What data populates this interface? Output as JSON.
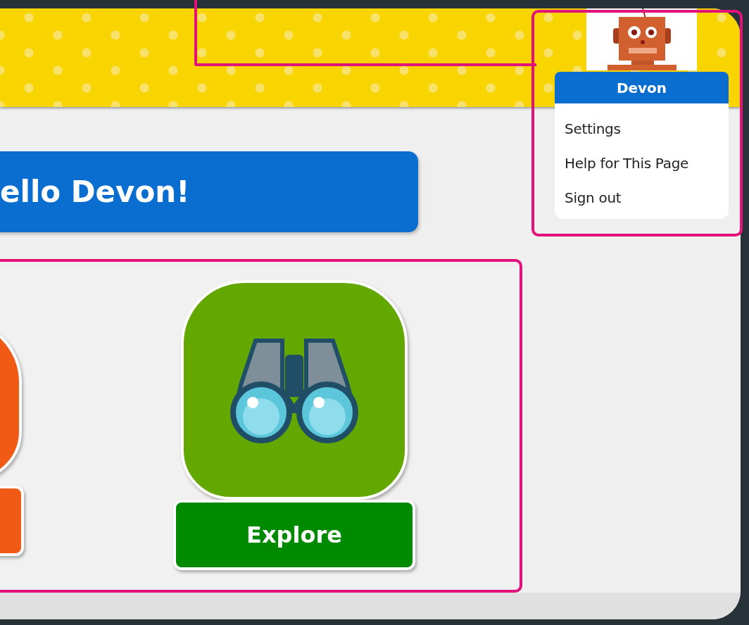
{
  "user_menu": {
    "name": "Devon",
    "items": [
      "Settings",
      "Help for This Page",
      "Sign out"
    ]
  },
  "greeting": "ello Devon!",
  "tiles": [
    {
      "color": "#f05a14",
      "button": {
        "color": "#f05a14"
      }
    },
    {
      "color": "#62a800",
      "button": {
        "label": "Explore",
        "color": "#008a00"
      }
    }
  ]
}
